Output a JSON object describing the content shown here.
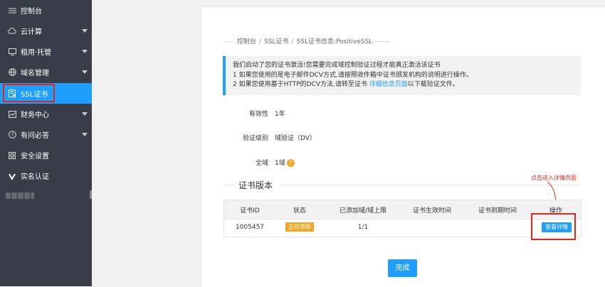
{
  "sidebar": {
    "items": [
      {
        "label": "控制台",
        "icon": "sliders-icon",
        "caret": false
      },
      {
        "label": "云计算",
        "icon": "cloud-icon",
        "caret": true
      },
      {
        "label": "租用·托管",
        "icon": "monitor-icon",
        "caret": true
      },
      {
        "label": "域名管理",
        "icon": "globe-icon",
        "caret": true
      },
      {
        "label": "SSL证书",
        "icon": "certificate-icon",
        "caret": false,
        "active": true
      },
      {
        "label": "财务中心",
        "icon": "chart-icon",
        "caret": true
      },
      {
        "label": "有问必答",
        "icon": "question-icon",
        "caret": true
      },
      {
        "label": "安全设置",
        "icon": "grid-icon",
        "caret": false
      },
      {
        "label": "实名认证",
        "icon": "v-icon",
        "caret": false
      }
    ]
  },
  "breadcrumb": {
    "items": [
      "控制台",
      "SSL证书",
      "SSL证书信息:PositiveSSL"
    ],
    "separator": "/"
  },
  "notice": {
    "line1": "我们启动了您的证书激活!您需要完成域控制验证过程才能真正激活该证书",
    "line2": "1   如果您使用的是电子邮件DCV方式,请按照收件箱中证书颁发机构的说明进行操作。",
    "line3_prefix": "2   如果您使用基于HTTP的DCV方法,请转至证书 ",
    "line3_link": "详细信息页面",
    "line3_suffix": "以下载验证文件。"
  },
  "fields": {
    "validity_label": "有效性",
    "validity_value": "1年",
    "level_label": "验证级别",
    "level_value": "域验证（DV）",
    "wildcard_label": "全域",
    "wildcard_value": "1域"
  },
  "section": {
    "title": "证书版本",
    "annotation": "点击进入详情页面"
  },
  "table": {
    "headers": [
      "证书ID",
      "状态",
      "已添加域/域上限",
      "证书生效时间",
      "证书到期时间",
      "操作"
    ],
    "row": {
      "id": "1005457",
      "status": "正在审核",
      "domains": "1/1",
      "start": "",
      "end": "",
      "action": "查看详情"
    }
  },
  "buttons": {
    "done": "完成"
  },
  "colors": {
    "sidebar_bg": "#393d49",
    "accent": "#1e9fff",
    "status": "#f5a623",
    "highlight": "#e1251b"
  }
}
